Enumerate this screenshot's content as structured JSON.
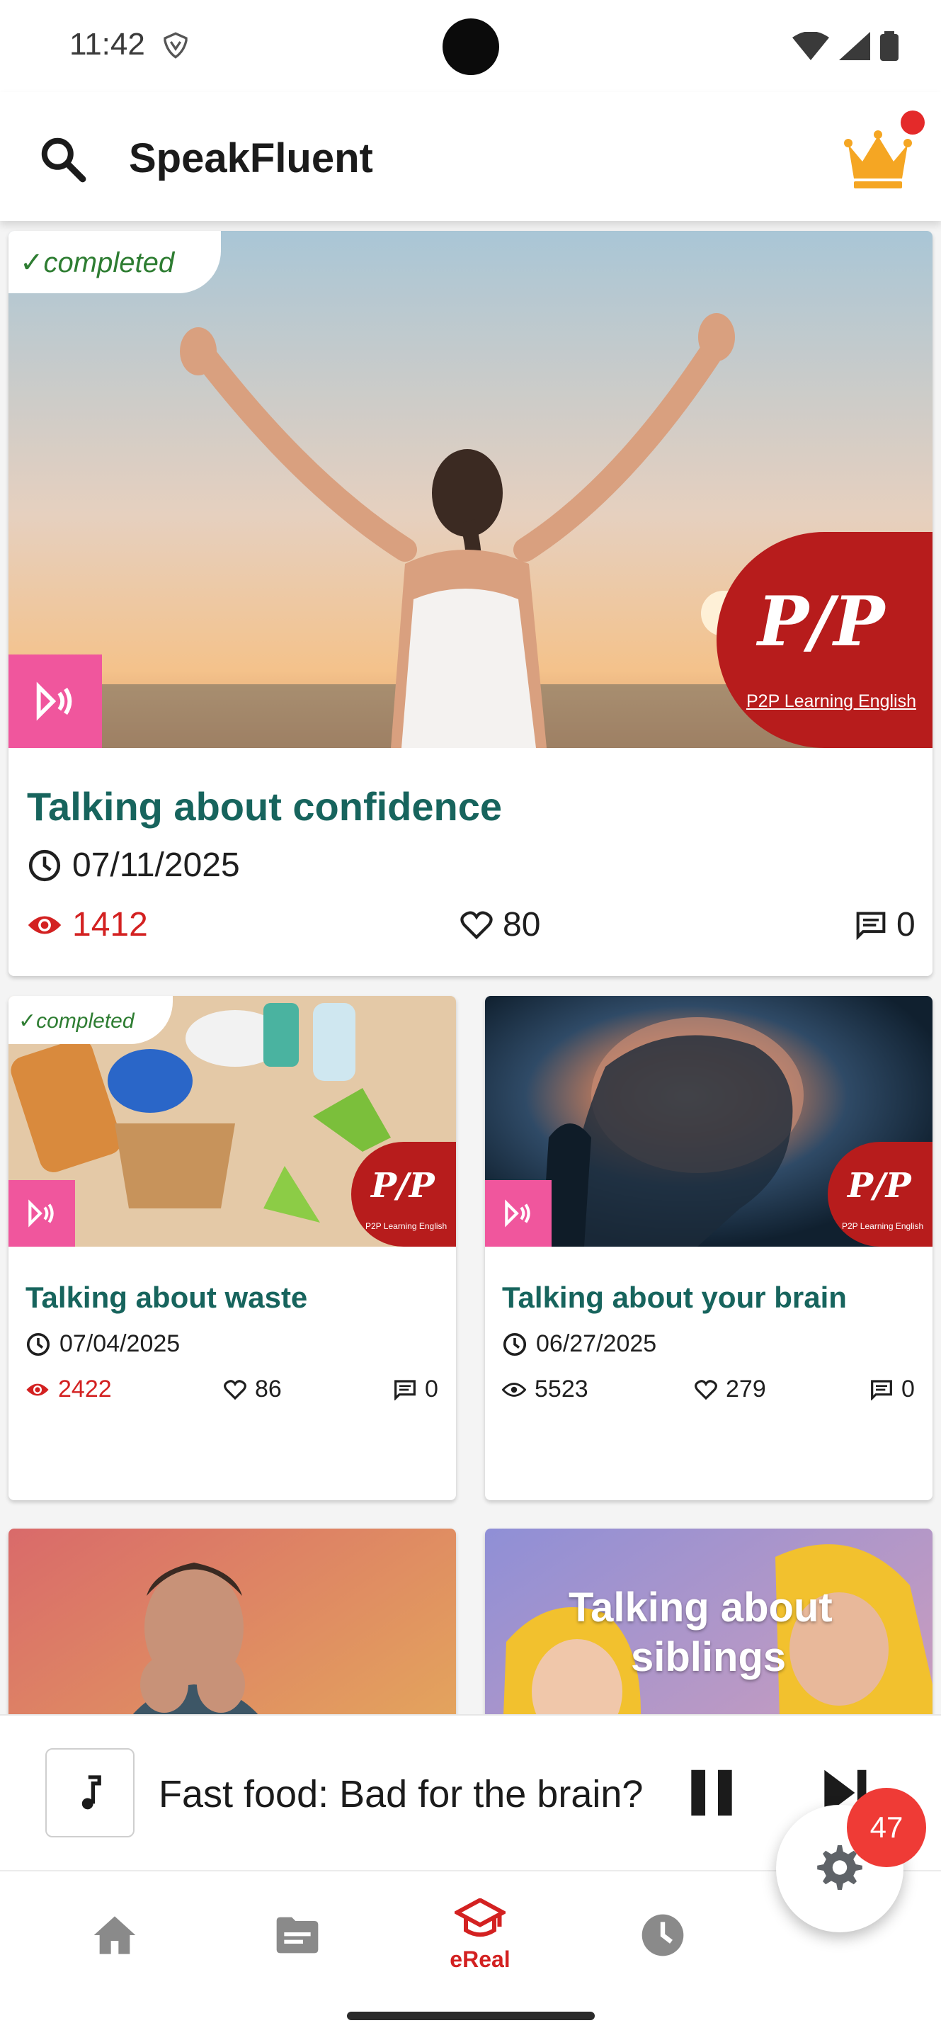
{
  "status_bar": {
    "time": "11:42"
  },
  "app_bar": {
    "title": "SpeakFluent"
  },
  "cards": [
    {
      "completed_label": "✓completed",
      "title": "Talking about confidence",
      "date": "07/11/2025",
      "views": "1412",
      "likes": "80",
      "comments": "0",
      "logo_text": "P/P",
      "logo_subtitle": "P2P Learning English"
    },
    {
      "completed_label": "✓completed",
      "title": "Talking about waste",
      "date": "07/04/2025",
      "views": "2422",
      "likes": "86",
      "comments": "0",
      "logo_text": "P/P",
      "logo_subtitle": "P2P Learning English"
    },
    {
      "title": "Talking about your brain",
      "date": "06/27/2025",
      "views": "5523",
      "likes": "279",
      "comments": "0",
      "logo_text": "P/P",
      "logo_subtitle": "P2P Learning English"
    },
    {
      "image_text": ""
    },
    {
      "image_text_line1": "Talking about",
      "image_text_line2": "siblings"
    }
  ],
  "mini_player": {
    "title": "Fast food: Bad for the brain?"
  },
  "settings_badge": "47",
  "bottom_nav": {
    "items": [
      {
        "icon": "home-icon",
        "label": ""
      },
      {
        "icon": "folder-icon",
        "label": ""
      },
      {
        "icon": "graduation-cap-icon",
        "label": "eReal"
      },
      {
        "icon": "clock-icon",
        "label": ""
      }
    ]
  },
  "colors": {
    "accent": "#d32121",
    "title_teal": "#17645d",
    "completed_green": "#2e7d32",
    "audio_pink": "#f0569d",
    "logo_red": "#b71c1c",
    "crown_gold": "#f5a623"
  }
}
